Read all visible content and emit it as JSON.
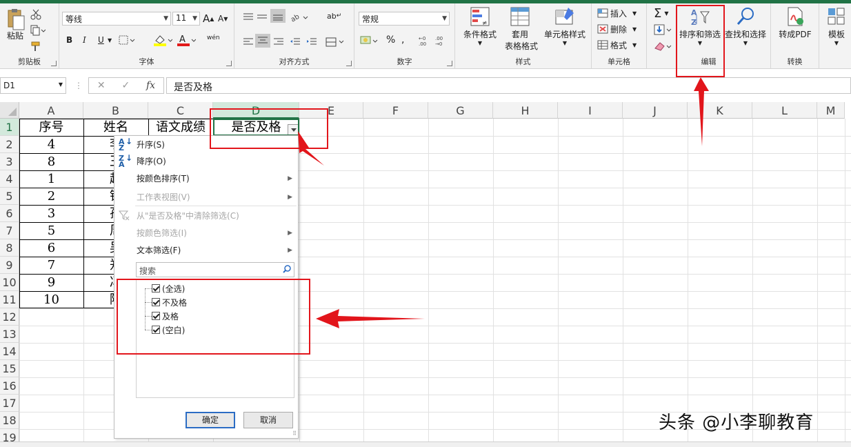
{
  "ribbon": {
    "clipboard": {
      "label": "剪贴板",
      "paste": "粘贴"
    },
    "font": {
      "label": "字体",
      "font_name": "等线",
      "font_size": "11",
      "grow": "A",
      "shrink": "A",
      "bold": "B",
      "italic": "I",
      "underline": "U",
      "wen": "wén"
    },
    "alignment": {
      "label": "对齐方式",
      "abc": "ab"
    },
    "number": {
      "label": "数字",
      "format": "常规",
      "percent": "%"
    },
    "styles": {
      "label": "样式",
      "conditional": "条件格式",
      "table_line1": "套用",
      "table_line2": "表格格式",
      "cell_styles": "单元格样式"
    },
    "cells": {
      "label": "单元格",
      "insert": "插入",
      "delete": "删除",
      "format": "格式"
    },
    "editing": {
      "label": "编辑",
      "sort_filter": "排序和筛选",
      "find_select": "查找和选择"
    },
    "convert": {
      "label": "转换",
      "to_pdf": "转成PDF"
    },
    "template": {
      "label": "模板"
    }
  },
  "formula_bar": {
    "namebox": "D1",
    "fx": "fx",
    "content": "是否及格"
  },
  "columns": [
    "A",
    "B",
    "C",
    "D",
    "E",
    "F",
    "G",
    "H",
    "I",
    "J",
    "K",
    "L",
    "M"
  ],
  "rows": [
    "1",
    "2",
    "3",
    "4",
    "5",
    "6",
    "7",
    "8",
    "9",
    "10",
    "11",
    "12",
    "13",
    "14",
    "15",
    "16",
    "17",
    "18",
    "19"
  ],
  "table": {
    "headers": [
      "序号",
      "姓名",
      "语文成绩",
      "是否及格"
    ],
    "col_a": [
      "4",
      "8",
      "1",
      "2",
      "3",
      "5",
      "6",
      "7",
      "9",
      "10"
    ],
    "col_b": [
      "李",
      "王",
      "赵",
      "钱",
      "孙",
      "周",
      "吴",
      "郑",
      "冯",
      "陈"
    ]
  },
  "filter_menu": {
    "sort_asc": "升序(S)",
    "sort_desc": "降序(O)",
    "sort_by_color": "按颜色排序(T)",
    "sheet_view": "工作表视图(V)",
    "clear_filter": "从\"是否及格\"中清除筛选(C)",
    "filter_by_color": "按颜色筛选(I)",
    "text_filter": "文本筛选(F)",
    "search_placeholder": "搜索",
    "items": [
      "(全选)",
      "不及格",
      "及格",
      "(空白)"
    ],
    "ok": "确定",
    "cancel": "取消"
  },
  "watermark": "头条 @小李聊教育",
  "colors": {
    "excel_green": "#217346",
    "annotation_red": "#e2151b"
  }
}
